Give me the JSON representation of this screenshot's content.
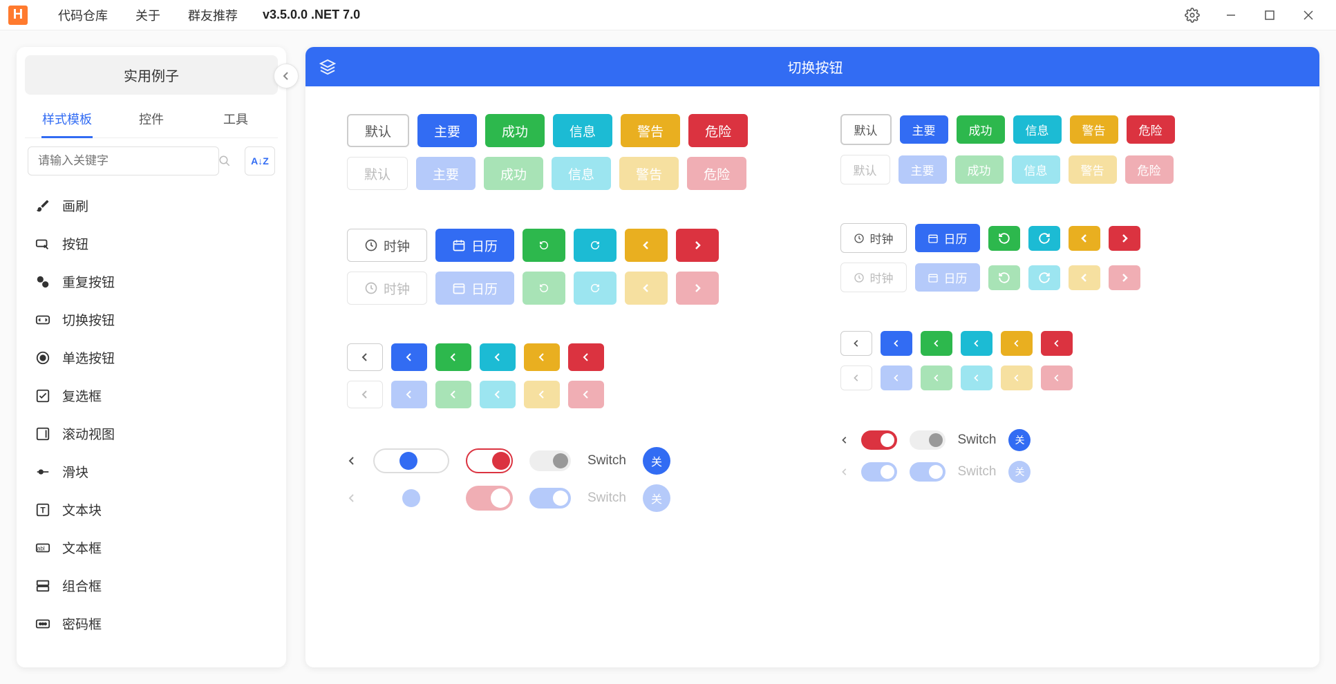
{
  "titlebar": {
    "logo": "H",
    "menu": [
      "代码仓库",
      "关于",
      "群友推荐"
    ],
    "version": "v3.5.0.0 .NET 7.0"
  },
  "sidebar": {
    "title": "实用例子",
    "tabs": [
      "样式模板",
      "控件",
      "工具"
    ],
    "active_tab": 0,
    "search_placeholder": "请输入关键字",
    "sort_label": "A↓Z",
    "items": [
      {
        "icon": "brush",
        "label": "画刷"
      },
      {
        "icon": "button",
        "label": "按钮"
      },
      {
        "icon": "repeat",
        "label": "重复按钮"
      },
      {
        "icon": "toggle",
        "label": "切换按钮"
      },
      {
        "icon": "radio",
        "label": "单选按钮"
      },
      {
        "icon": "check",
        "label": "复选框"
      },
      {
        "icon": "scroll",
        "label": "滚动视图"
      },
      {
        "icon": "slider",
        "label": "滑块"
      },
      {
        "icon": "textblock",
        "label": "文本块"
      },
      {
        "icon": "textbox",
        "label": "文本框"
      },
      {
        "icon": "combo",
        "label": "组合框"
      },
      {
        "icon": "password",
        "label": "密码框"
      }
    ]
  },
  "main": {
    "title": "切换按钮",
    "variants": [
      "默认",
      "主要",
      "成功",
      "信息",
      "警告",
      "危险"
    ],
    "clock_label": "时钟",
    "calendar_label": "日历",
    "switch_label": "Switch",
    "close_label": "关"
  },
  "colors": {
    "primary": "#326cf3",
    "success": "#2db84d",
    "info": "#1cbbd4",
    "warning": "#e9af20",
    "danger": "#db3340"
  }
}
